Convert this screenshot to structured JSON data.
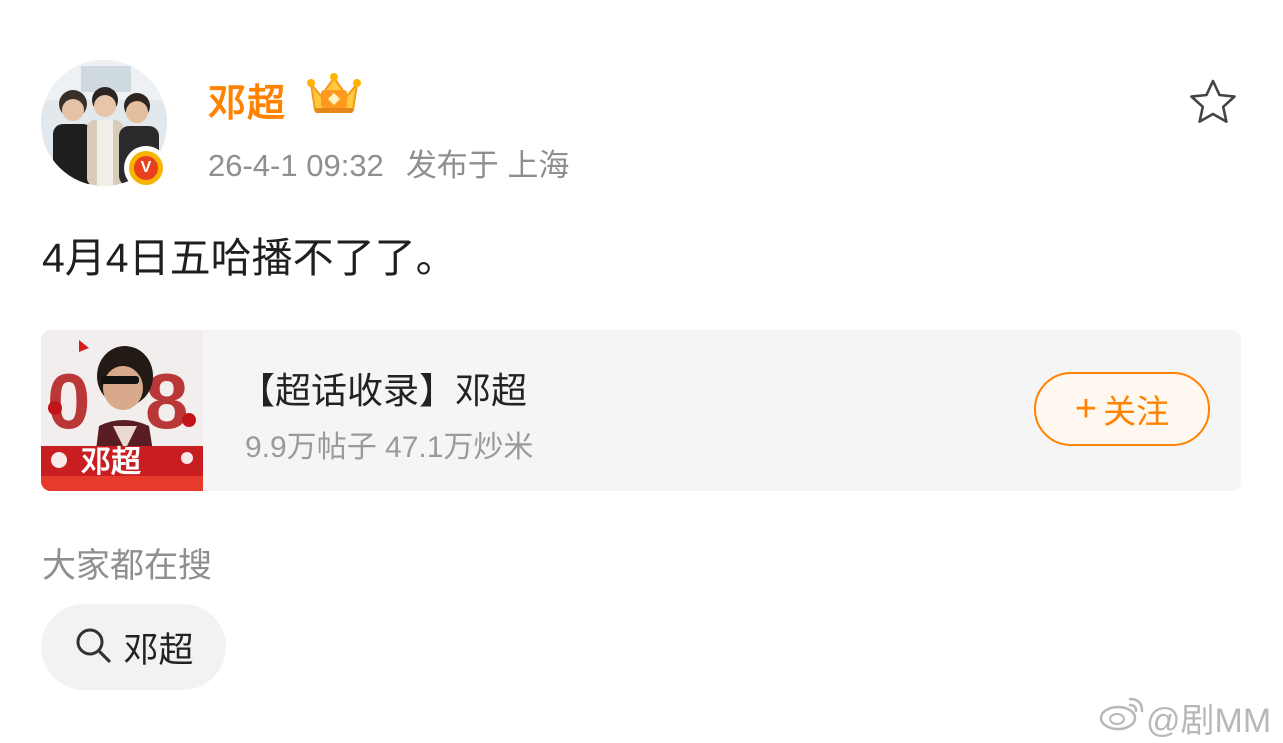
{
  "post": {
    "username": "邓超",
    "timestamp": "26-4-1 09:32",
    "location": "发布于 上海",
    "content": "4月4日五哈播不了了。",
    "icons": {
      "verified": "verified-v-badge-icon",
      "member": "crown-member-icon",
      "favorite": "star-icon"
    }
  },
  "super_topic_card": {
    "title": "【超话收录】邓超",
    "stats": "9.9万帖子 47.1万炒米",
    "follow_label": "关注",
    "follow_icon": "plus-icon",
    "thumb_text": "邓超"
  },
  "hot_search": {
    "section_title": "大家都在搜",
    "chips": [
      {
        "icon": "search-icon",
        "label": "邓超"
      }
    ]
  },
  "watermark": {
    "text": "@剧MM",
    "icon": "weibo-logo-icon"
  },
  "colors": {
    "accent": "#ff8200",
    "meta_gray": "#8f8f8f",
    "card_bg": "#f5f5f5",
    "verified_red": "#e8401c",
    "verified_gold": "#f7b500"
  }
}
